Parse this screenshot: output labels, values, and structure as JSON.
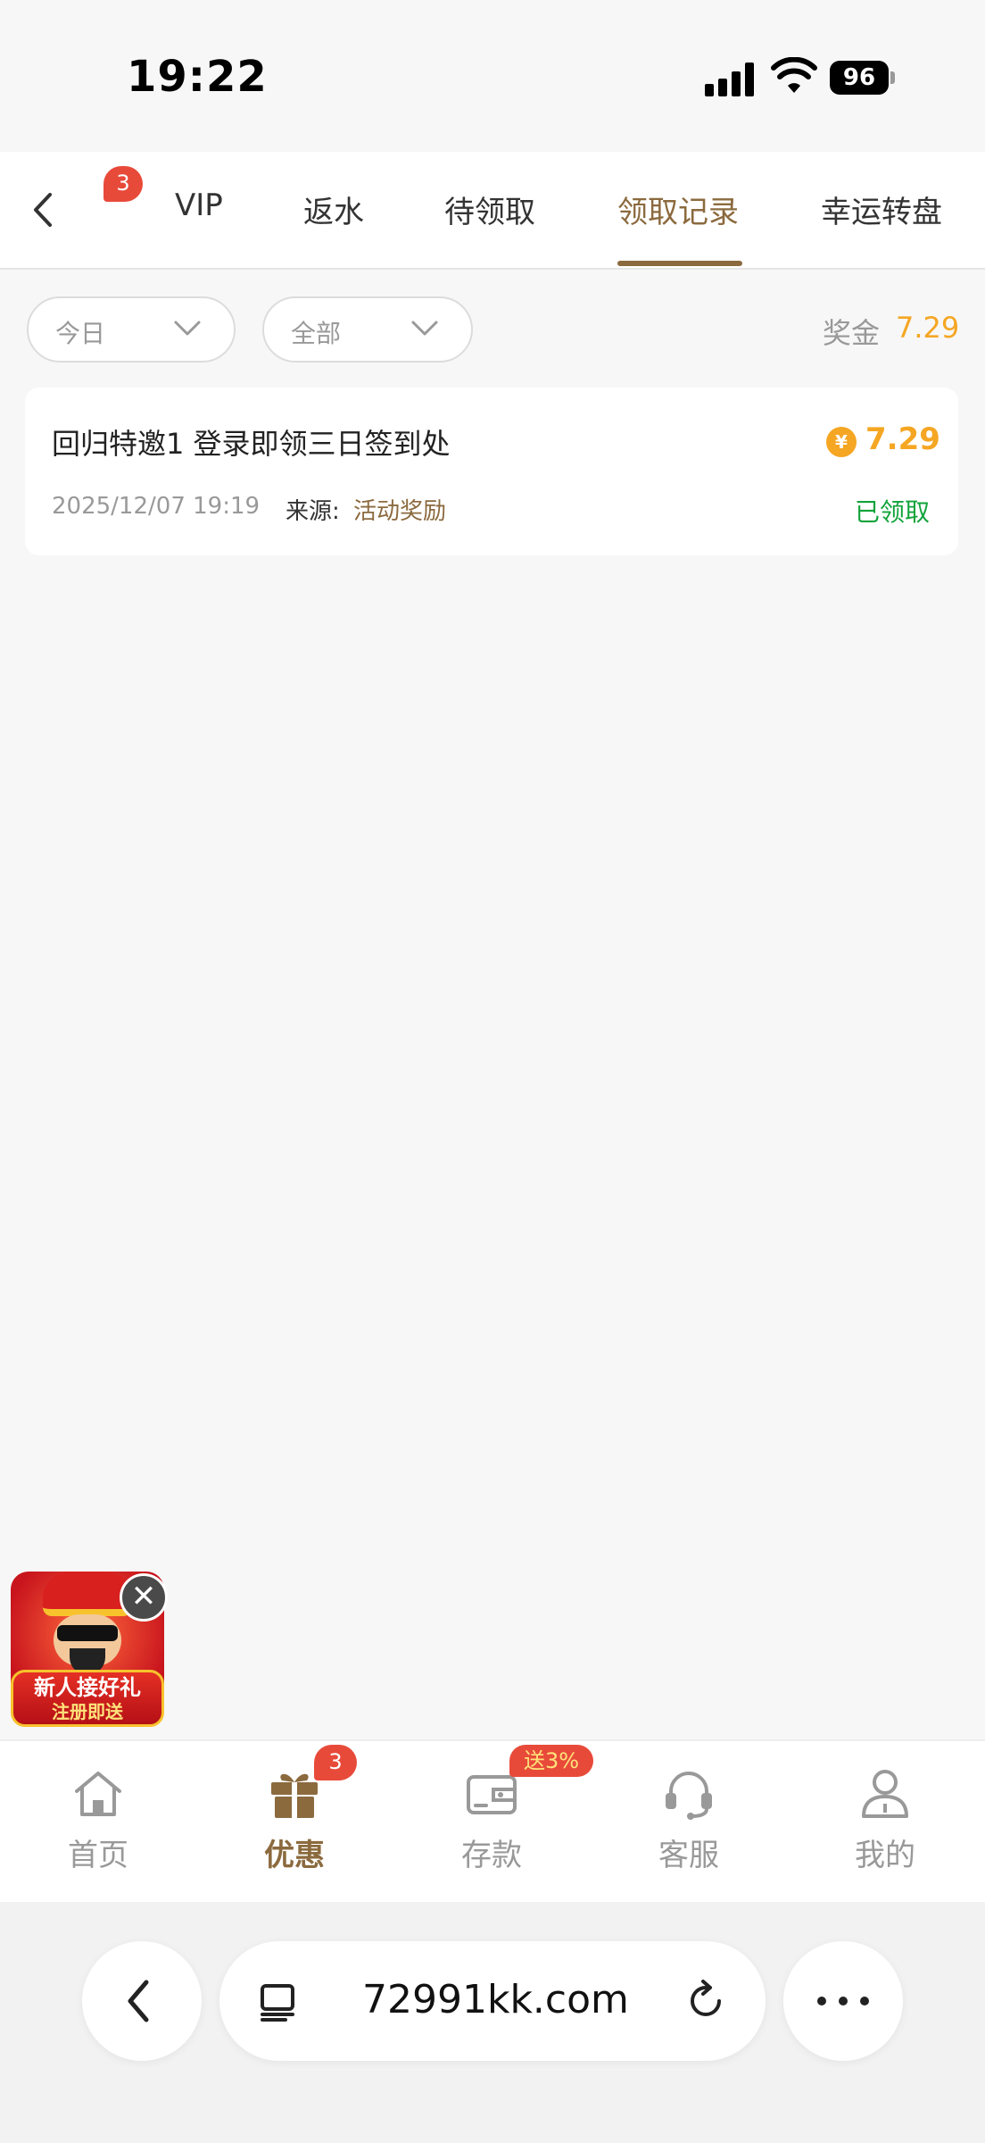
{
  "status_bar": {
    "time": "19:22",
    "battery": "96"
  },
  "header": {
    "notification_count": "3",
    "tabs": [
      {
        "label": "VIP"
      },
      {
        "label": "返水"
      },
      {
        "label": "待领取"
      },
      {
        "label": "领取记录"
      },
      {
        "label": "幸运转盘"
      }
    ],
    "active_tab": "领取记录"
  },
  "filters": {
    "date": "今日",
    "type": "全部",
    "bonus_label": "奖金",
    "bonus_total": "7.29"
  },
  "records": [
    {
      "title": "回归特邀1 登录即领三日签到处",
      "currency_symbol": "¥",
      "amount": "7.29",
      "date": "2025/12/07 19:19",
      "source_label": "来源:",
      "source": "活动奖励",
      "status": "已领取"
    }
  ],
  "promo": {
    "line1": "新人接好礼",
    "line2": "注册即送",
    "close": "✕"
  },
  "bottom_nav": {
    "items": [
      {
        "label": "首页",
        "icon": "home-icon"
      },
      {
        "label": "优惠",
        "icon": "gift-icon",
        "badge": "3"
      },
      {
        "label": "存款",
        "icon": "wallet-icon",
        "tag": "送3%"
      },
      {
        "label": "客服",
        "icon": "headset-icon"
      },
      {
        "label": "我的",
        "icon": "user-icon"
      }
    ],
    "active": "优惠"
  },
  "browser": {
    "url": "72991kk.com"
  },
  "colors": {
    "accent_brown": "#8b6a3e",
    "amount_orange": "#f5a623",
    "status_green": "#12a33a",
    "badge_red": "#e84a3a"
  }
}
